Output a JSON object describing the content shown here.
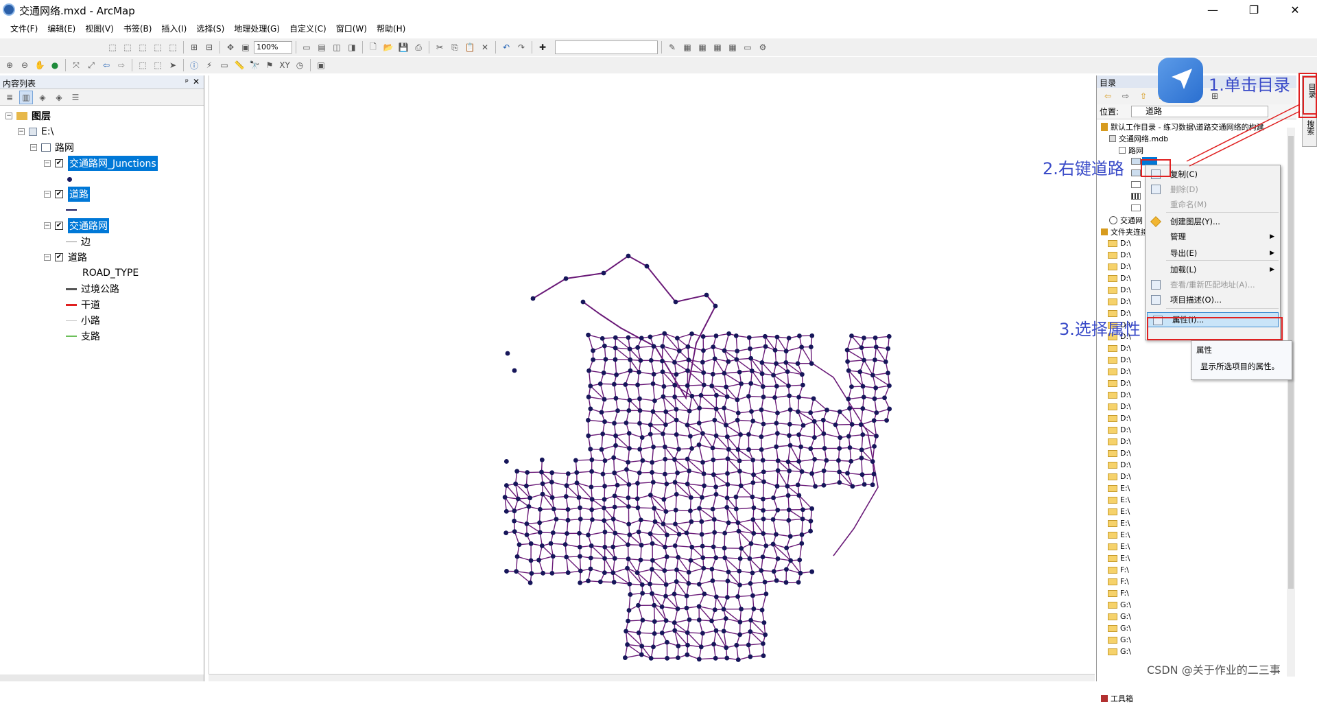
{
  "window": {
    "title": "交通网络.mxd - ArcMap",
    "minimize": "—",
    "restore": "❐",
    "close": "✕"
  },
  "menu": [
    "文件(F)",
    "编辑(E)",
    "视图(V)",
    "书签(B)",
    "插入(I)",
    "选择(S)",
    "地理处理(G)",
    "自定义(C)",
    "窗口(W)",
    "帮助(H)"
  ],
  "toolbar": {
    "zoom": "100%"
  },
  "toc": {
    "title": "内容列表",
    "pin": "ᵖ",
    "close": "✕",
    "root": "图层",
    "source": "E:\\",
    "dataset": "路网",
    "layers": [
      {
        "name": "交通路网_Junctions",
        "selected": true
      },
      {
        "name": "道路",
        "selected": true
      },
      {
        "name": "交通路网",
        "selected": true
      },
      {
        "name": "道路",
        "selected": false
      }
    ],
    "edge_label": "边",
    "field": "ROAD_TYPE",
    "legend": [
      {
        "label": "过境公路",
        "color": "#555555"
      },
      {
        "label": "干道",
        "color": "#e02020"
      },
      {
        "label": "小路",
        "color": "#bdbdbd"
      },
      {
        "label": "支路",
        "color": "#6cbf5a"
      }
    ]
  },
  "catalog": {
    "title": "目录",
    "location_label": "位置:",
    "location_value": "道路",
    "home": "默认工作目录 - 练习数据\\道路交通网络的构建",
    "mdb": "交通网络.mdb",
    "dataset": "路网",
    "network": "交通网",
    "folder_conn": "文件夹连接",
    "folders": [
      "D:\\",
      "D:\\",
      "D:\\",
      "D:\\",
      "D:\\",
      "D:\\",
      "D:\\",
      "D:\\",
      "D:\\",
      "D:\\",
      "D:\\",
      "D:\\",
      "D:\\",
      "D:\\",
      "D:\\",
      "D:\\",
      "D:\\",
      "D:\\",
      "D:\\",
      "D:\\",
      "D:\\",
      "E:\\",
      "E:\\",
      "E:\\",
      "E:\\",
      "E:\\",
      "E:\\",
      "E:\\",
      "F:\\",
      "F:\\",
      "F:\\",
      "G:\\",
      "G:\\",
      "G:\\",
      "G:\\",
      "G:\\"
    ],
    "toolbox": "工具箱"
  },
  "context_menu": [
    {
      "label": "复制(C)",
      "enabled": true,
      "icon": "copy-icon"
    },
    {
      "label": "删除(D)",
      "enabled": false,
      "icon": "delete-icon"
    },
    {
      "label": "重命名(M)",
      "enabled": false,
      "icon": ""
    },
    {
      "label": "创建图层(Y)...",
      "enabled": true,
      "icon": "layer-icon"
    },
    {
      "label": "管理",
      "enabled": true,
      "submenu": true
    },
    {
      "label": "导出(E)",
      "enabled": true,
      "submenu": true
    },
    {
      "label": "加载(L)",
      "enabled": true,
      "submenu": true
    },
    {
      "label": "查看/重新匹配地址(A)...",
      "enabled": false,
      "icon": "address-icon"
    },
    {
      "label": "项目描述(O)...",
      "enabled": true,
      "icon": "description-icon"
    },
    {
      "label": "属性(I)...",
      "enabled": true,
      "highlighted": true,
      "icon": "properties-icon"
    }
  ],
  "tooltip": {
    "title": "属性",
    "text": "显示所选项目的属性。"
  },
  "annotations": [
    "1.单击目录",
    "2.右键道路",
    "3.选择属性"
  ],
  "right_dock": [
    "目录",
    "搜索"
  ],
  "watermark": "CSDN @关于作业的二三事"
}
